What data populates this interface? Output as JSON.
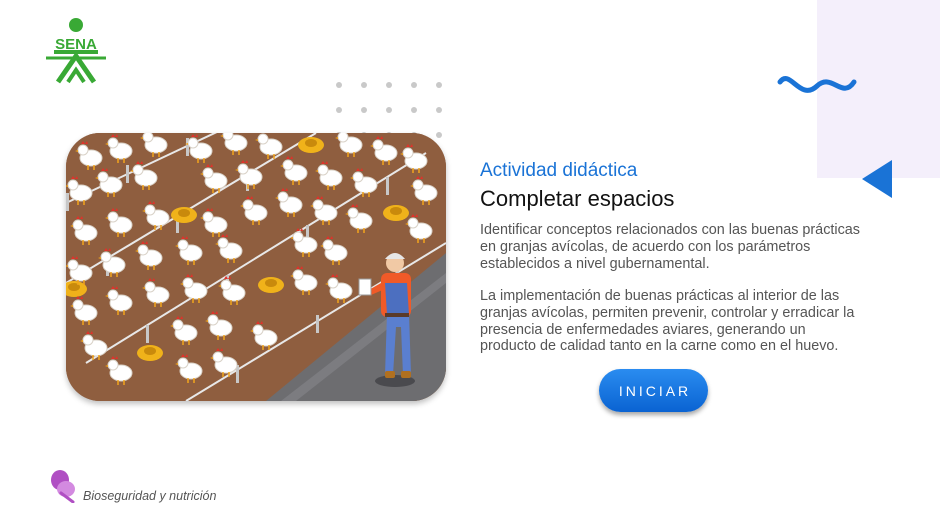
{
  "logo": {
    "text": "SENA",
    "color": "#39a935"
  },
  "decor": {
    "accent": "#1a73d6",
    "lavender": "#f4effb"
  },
  "activity": {
    "subtitle": "Actividad didáctica",
    "title": "Completar espacios",
    "paragraph1": "Identificar conceptos relacionados con las buenas prácticas en granjas avícolas, de acuerdo con los parámetros establecidos a nivel gubernamental.",
    "paragraph2": "La implementación de buenas prácticas al interior de las granjas avícolas, permiten prevenir, controlar y erradicar la presencia de enfermedades aviares, generando un producto de calidad tanto en la carne como en el huevo."
  },
  "start_button": {
    "label": "INICIAR"
  },
  "footer": {
    "course": "Bioseguridad y nutrición",
    "icon": "leaf-blob-icon"
  },
  "illustration": {
    "subject": "chickens-farm-illustration"
  }
}
